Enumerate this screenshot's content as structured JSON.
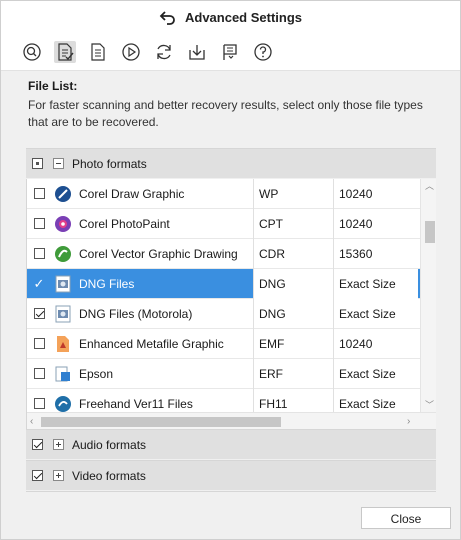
{
  "window": {
    "title": "Advanced Settings"
  },
  "toolbar": {
    "buttons": [
      {
        "icon": "scan-icon"
      },
      {
        "icon": "file-list-icon",
        "active": true
      },
      {
        "icon": "file-settings-icon"
      },
      {
        "icon": "play-icon"
      },
      {
        "icon": "refresh-icon"
      },
      {
        "icon": "download-icon"
      },
      {
        "icon": "flag-icon"
      },
      {
        "icon": "help-icon"
      }
    ]
  },
  "file_list": {
    "title": "File List:",
    "description": "For faster scanning and better recovery results, select only those file types that are to be recovered."
  },
  "groups": {
    "photo": {
      "label": "Photo formats",
      "state": "partial",
      "expanded": true
    },
    "audio": {
      "label": "Audio formats",
      "state": "checked",
      "expanded": false
    },
    "video": {
      "label": "Video formats",
      "state": "checked",
      "expanded": false
    }
  },
  "rows": [
    {
      "name": "Corel Draw Graphic",
      "ext": "WP",
      "size": "10240",
      "checked": false,
      "selected": false,
      "icon": "corel-draw-icon"
    },
    {
      "name": "Corel PhotoPaint",
      "ext": "CPT",
      "size": "10240",
      "checked": false,
      "selected": false,
      "icon": "corel-photopaint-icon"
    },
    {
      "name": "Corel Vector Graphic Drawing",
      "ext": "CDR",
      "size": "15360",
      "checked": false,
      "selected": false,
      "icon": "corel-vector-icon"
    },
    {
      "name": "DNG Files",
      "ext": "DNG",
      "size": "Exact Size",
      "checked": true,
      "selected": true,
      "icon": "dng-file-icon"
    },
    {
      "name": "DNG Files (Motorola)",
      "ext": "DNG",
      "size": "Exact Size",
      "checked": true,
      "selected": false,
      "icon": "dng-file-icon"
    },
    {
      "name": "Enhanced Metafile Graphic",
      "ext": "EMF",
      "size": "10240",
      "checked": false,
      "selected": false,
      "icon": "emf-file-icon"
    },
    {
      "name": "Epson",
      "ext": "ERF",
      "size": "Exact Size",
      "checked": false,
      "selected": false,
      "icon": "epson-file-icon"
    },
    {
      "name": "Freehand Ver11 Files",
      "ext": "FH11",
      "size": "Exact Size",
      "checked": false,
      "selected": false,
      "icon": "freehand-icon"
    }
  ],
  "buttons": {
    "close": "Close"
  }
}
